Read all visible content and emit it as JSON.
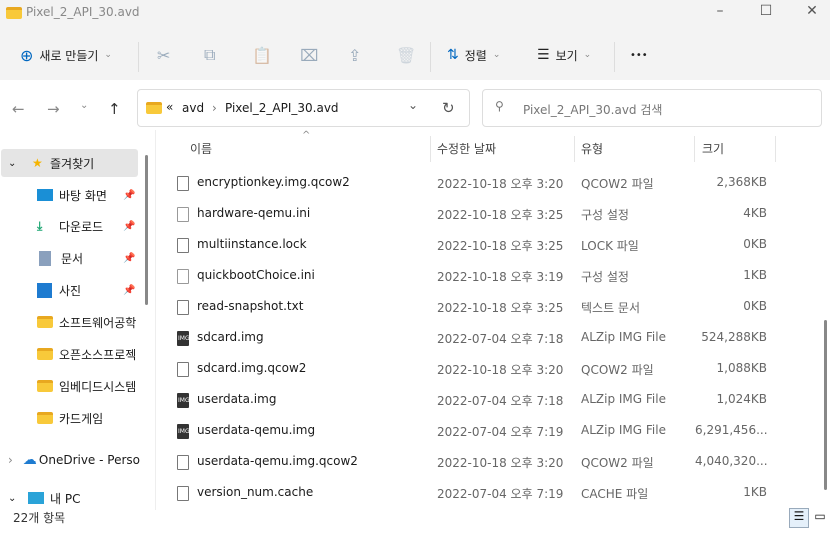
{
  "window": {
    "title": "Pixel_2_API_30.avd",
    "minimize": "–",
    "maximize": "☐",
    "close": "✕"
  },
  "toolbar": {
    "new_label": "새로 만들기",
    "sort_label": "정렬",
    "view_label": "보기",
    "more": "•••",
    "cut": "✂",
    "copy": "⧉",
    "paste": "📋",
    "rename": "⌧",
    "share": "⇪",
    "delete": "🗑"
  },
  "address": {
    "back": "←",
    "forward": "→",
    "recent": "⌄",
    "up": "↑",
    "overflow": "«",
    "crumbs": [
      "avd",
      "Pixel_2_API_30.avd"
    ],
    "sep": "›",
    "dropdown": "⌄",
    "refresh": "↻"
  },
  "search": {
    "placeholder": "Pixel_2_API_30.avd 검색",
    "icon": "⚲"
  },
  "sidebar": {
    "items": [
      {
        "label": "즐겨찾기",
        "icon": "star-icon"
      },
      {
        "label": "바탕 화면",
        "icon": "desktop-icon",
        "pinned": true
      },
      {
        "label": "다운로드",
        "icon": "download-icon",
        "pinned": true
      },
      {
        "label": "문서",
        "icon": "document-icon",
        "pinned": true
      },
      {
        "label": "사진",
        "icon": "pictures-icon",
        "pinned": true
      },
      {
        "label": "소프트웨어공학",
        "icon": "folder-icon"
      },
      {
        "label": "오픈소스프로젝",
        "icon": "folder-icon"
      },
      {
        "label": "임베디드시스템",
        "icon": "folder-icon"
      },
      {
        "label": "카드게임",
        "icon": "folder-icon"
      },
      {
        "label": "OneDrive - Perso",
        "icon": "cloud-icon"
      },
      {
        "label": "내 PC",
        "icon": "pc-icon"
      }
    ]
  },
  "columns": {
    "name": "이름",
    "date": "수정한 날짜",
    "type": "유형",
    "size": "크기",
    "sort_arrow": "^"
  },
  "files": [
    {
      "name": "encryptionkey.img.qcow2",
      "date": "2022-10-18 오후 3:20",
      "type": "QCOW2 파일",
      "size": "2,368KB",
      "kind": "file"
    },
    {
      "name": "hardware-qemu.ini",
      "date": "2022-10-18 오후 3:25",
      "type": "구성 설정",
      "size": "4KB",
      "kind": "ini"
    },
    {
      "name": "multiinstance.lock",
      "date": "2022-10-18 오후 3:25",
      "type": "LOCK 파일",
      "size": "0KB",
      "kind": "file"
    },
    {
      "name": "quickbootChoice.ini",
      "date": "2022-10-18 오후 3:19",
      "type": "구성 설정",
      "size": "1KB",
      "kind": "ini"
    },
    {
      "name": "read-snapshot.txt",
      "date": "2022-10-18 오후 3:25",
      "type": "텍스트 문서",
      "size": "0KB",
      "kind": "file"
    },
    {
      "name": "sdcard.img",
      "date": "2022-07-04 오후 7:18",
      "type": "ALZip IMG File",
      "size": "524,288KB",
      "kind": "img"
    },
    {
      "name": "sdcard.img.qcow2",
      "date": "2022-10-18 오후 3:20",
      "type": "QCOW2 파일",
      "size": "1,088KB",
      "kind": "file"
    },
    {
      "name": "userdata.img",
      "date": "2022-07-04 오후 7:18",
      "type": "ALZip IMG File",
      "size": "1,024KB",
      "kind": "img"
    },
    {
      "name": "userdata-qemu.img",
      "date": "2022-07-04 오후 7:19",
      "type": "ALZip IMG File",
      "size": "6,291,456...",
      "kind": "img"
    },
    {
      "name": "userdata-qemu.img.qcow2",
      "date": "2022-10-18 오후 3:20",
      "type": "QCOW2 파일",
      "size": "4,040,320...",
      "kind": "file"
    },
    {
      "name": "version_num.cache",
      "date": "2022-07-04 오후 7:19",
      "type": "CACHE 파일",
      "size": "1KB",
      "kind": "file"
    }
  ],
  "status": {
    "count": "22개 항목"
  }
}
